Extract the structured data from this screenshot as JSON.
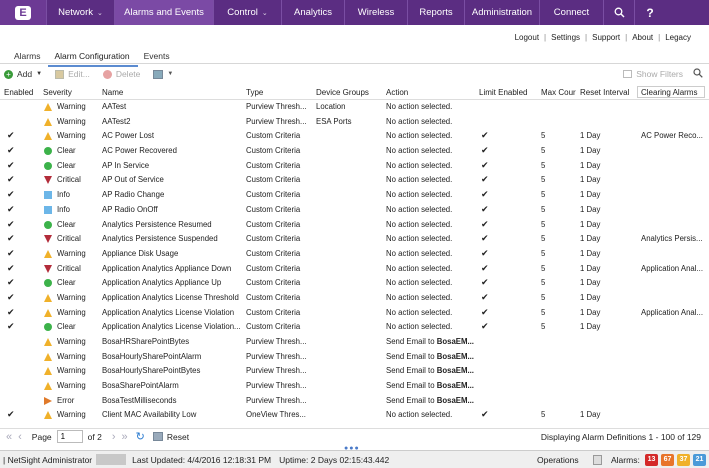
{
  "nav": {
    "logo": "E",
    "items": [
      {
        "label": "Network",
        "dropdown": true,
        "width": 68
      },
      {
        "label": "Alarms and Events",
        "dropdown": false,
        "width": 99,
        "active": true
      },
      {
        "label": "Control",
        "dropdown": true,
        "width": 68
      },
      {
        "label": "Analytics",
        "dropdown": false,
        "width": 63
      },
      {
        "label": "Wireless",
        "dropdown": false,
        "width": 63
      },
      {
        "label": "Reports",
        "dropdown": false,
        "width": 57
      },
      {
        "label": "Administration",
        "dropdown": false,
        "width": 75
      },
      {
        "label": "Connect",
        "dropdown": false,
        "width": 64
      }
    ],
    "search_icon": "search-icon",
    "help_label": "?"
  },
  "links": [
    "Logout",
    "Settings",
    "Support",
    "About",
    "Legacy"
  ],
  "tabs": [
    {
      "label": "Alarms",
      "active": false
    },
    {
      "label": "Alarm Configuration",
      "active": true
    },
    {
      "label": "Events",
      "active": false
    }
  ],
  "toolbar": {
    "add": "Add",
    "edit": "Edit...",
    "delete": "Delete",
    "show_filters": "Show Filters"
  },
  "columns": {
    "enabled": "Enabled",
    "severity": "Severity",
    "name": "Name",
    "type": "Type",
    "device_groups": "Device Groups",
    "action": "Action",
    "limit_enabled": "Limit Enabled",
    "max_count": "Max Cour",
    "reset_interval": "Reset Interval",
    "clearing_alarms": "Clearing Alarms"
  },
  "rows": [
    {
      "enabled": "",
      "severity": "Warning",
      "icon": "warning",
      "name": "AATest",
      "type": "Purview Thresh...",
      "device_groups": "Location",
      "action": "No action selected.",
      "limit": "",
      "max": "",
      "reset": "",
      "clearing": ""
    },
    {
      "enabled": "",
      "severity": "Warning",
      "icon": "warning",
      "name": "AATest2",
      "type": "Purview Thresh...",
      "device_groups": "ESA Ports",
      "action": "No action selected.",
      "limit": "",
      "max": "",
      "reset": "",
      "clearing": ""
    },
    {
      "enabled": "✔",
      "severity": "Warning",
      "icon": "warning",
      "name": "AC Power Lost",
      "type": "Custom Criteria",
      "device_groups": "",
      "action": "No action selected.",
      "limit": "✔",
      "max": "5",
      "reset": "1 Day",
      "clearing": "AC Power Reco..."
    },
    {
      "enabled": "✔",
      "severity": "Clear",
      "icon": "clear",
      "name": "AC Power Recovered",
      "type": "Custom Criteria",
      "device_groups": "",
      "action": "No action selected.",
      "limit": "✔",
      "max": "5",
      "reset": "1 Day",
      "clearing": ""
    },
    {
      "enabled": "✔",
      "severity": "Clear",
      "icon": "clear",
      "name": "AP In Service",
      "type": "Custom Criteria",
      "device_groups": "",
      "action": "No action selected.",
      "limit": "✔",
      "max": "5",
      "reset": "1 Day",
      "clearing": ""
    },
    {
      "enabled": "✔",
      "severity": "Critical",
      "icon": "critical",
      "name": "AP Out of Service",
      "type": "Custom Criteria",
      "device_groups": "",
      "action": "No action selected.",
      "limit": "✔",
      "max": "5",
      "reset": "1 Day",
      "clearing": ""
    },
    {
      "enabled": "✔",
      "severity": "Info",
      "icon": "info",
      "name": "AP Radio Change",
      "type": "Custom Criteria",
      "device_groups": "",
      "action": "No action selected.",
      "limit": "✔",
      "max": "5",
      "reset": "1 Day",
      "clearing": ""
    },
    {
      "enabled": "✔",
      "severity": "Info",
      "icon": "info",
      "name": "AP Radio OnOff",
      "type": "Custom Criteria",
      "device_groups": "",
      "action": "No action selected.",
      "limit": "✔",
      "max": "5",
      "reset": "1 Day",
      "clearing": ""
    },
    {
      "enabled": "✔",
      "severity": "Clear",
      "icon": "clear",
      "name": "Analytics Persistence Resumed",
      "type": "Custom Criteria",
      "device_groups": "",
      "action": "No action selected.",
      "limit": "✔",
      "max": "5",
      "reset": "1 Day",
      "clearing": ""
    },
    {
      "enabled": "✔",
      "severity": "Critical",
      "icon": "critical",
      "name": "Analytics Persistence Suspended",
      "type": "Custom Criteria",
      "device_groups": "",
      "action": "No action selected.",
      "limit": "✔",
      "max": "5",
      "reset": "1 Day",
      "clearing": "Analytics Persis..."
    },
    {
      "enabled": "✔",
      "severity": "Warning",
      "icon": "warning",
      "name": "Appliance Disk Usage",
      "type": "Custom Criteria",
      "device_groups": "",
      "action": "No action selected.",
      "limit": "✔",
      "max": "5",
      "reset": "1 Day",
      "clearing": ""
    },
    {
      "enabled": "✔",
      "severity": "Critical",
      "icon": "critical",
      "name": "Application Analytics Appliance Down",
      "type": "Custom Criteria",
      "device_groups": "",
      "action": "No action selected.",
      "limit": "✔",
      "max": "5",
      "reset": "1 Day",
      "clearing": "Application Anal..."
    },
    {
      "enabled": "✔",
      "severity": "Clear",
      "icon": "clear",
      "name": "Application Analytics Appliance Up",
      "type": "Custom Criteria",
      "device_groups": "",
      "action": "No action selected.",
      "limit": "✔",
      "max": "5",
      "reset": "1 Day",
      "clearing": ""
    },
    {
      "enabled": "✔",
      "severity": "Warning",
      "icon": "warning",
      "name": "Application Analytics License Threshold",
      "type": "Custom Criteria",
      "device_groups": "",
      "action": "No action selected.",
      "limit": "✔",
      "max": "5",
      "reset": "1 Day",
      "clearing": ""
    },
    {
      "enabled": "✔",
      "severity": "Warning",
      "icon": "warning",
      "name": "Application Analytics License Violation",
      "type": "Custom Criteria",
      "device_groups": "",
      "action": "No action selected.",
      "limit": "✔",
      "max": "5",
      "reset": "1 Day",
      "clearing": "Application Anal..."
    },
    {
      "enabled": "✔",
      "severity": "Clear",
      "icon": "clear",
      "name": "Application Analytics License Violation...",
      "type": "Custom Criteria",
      "device_groups": "",
      "action": "No action selected.",
      "limit": "✔",
      "max": "5",
      "reset": "1 Day",
      "clearing": ""
    },
    {
      "enabled": "",
      "severity": "Warning",
      "icon": "warning",
      "name": "BosaHRSharePointBytes",
      "type": "Purview Thresh...",
      "device_groups": "",
      "action": "Send Email to ",
      "action_bold": "BosaEM...",
      "limit": "",
      "max": "",
      "reset": "",
      "clearing": ""
    },
    {
      "enabled": "",
      "severity": "Warning",
      "icon": "warning",
      "name": "BosaHourlySharePointAlarm",
      "type": "Purview Thresh...",
      "device_groups": "",
      "action": "Send Email to ",
      "action_bold": "BosaEM...",
      "limit": "",
      "max": "",
      "reset": "",
      "clearing": ""
    },
    {
      "enabled": "",
      "severity": "Warning",
      "icon": "warning",
      "name": "BosaHourlySharePointBytes",
      "type": "Purview Thresh...",
      "device_groups": "",
      "action": "Send Email to ",
      "action_bold": "BosaEM...",
      "limit": "",
      "max": "",
      "reset": "",
      "clearing": ""
    },
    {
      "enabled": "",
      "severity": "Warning",
      "icon": "warning",
      "name": "BosaSharePointAlarm",
      "type": "Purview Thresh...",
      "device_groups": "",
      "action": "Send Email to ",
      "action_bold": "BosaEM...",
      "limit": "",
      "max": "",
      "reset": "",
      "clearing": ""
    },
    {
      "enabled": "",
      "severity": "Error",
      "icon": "error",
      "name": "BosaTestMilliseconds",
      "type": "Purview Thresh...",
      "device_groups": "",
      "action": "Send Email to ",
      "action_bold": "BosaEM...",
      "limit": "",
      "max": "",
      "reset": "",
      "clearing": ""
    },
    {
      "enabled": "✔",
      "severity": "Warning",
      "icon": "warning",
      "name": "Client MAC Availability Low",
      "type": "OneView Thres...",
      "device_groups": "",
      "action": "No action selected.",
      "limit": "✔",
      "max": "5",
      "reset": "1 Day",
      "clearing": ""
    }
  ],
  "pager": {
    "page_label": "Page",
    "page_value": "1",
    "of_label": "of 2",
    "reset_label": "Reset",
    "display": "Displaying Alarm Definitions 1 - 100 of 129"
  },
  "status": {
    "user": "| NetSight Administrator",
    "updated": "Last Updated: 4/4/2016 12:18:31 PM",
    "uptime": "Uptime: 2 Days 02:15:43.442",
    "operations": "Operations",
    "alarms_label": "Alarms:",
    "badges": [
      {
        "count": "13",
        "color": "#d42a2a"
      },
      {
        "count": "67",
        "color": "#e8742a"
      },
      {
        "count": "37",
        "color": "#f0b12a"
      },
      {
        "count": "21",
        "color": "#4a9ad8"
      }
    ]
  }
}
